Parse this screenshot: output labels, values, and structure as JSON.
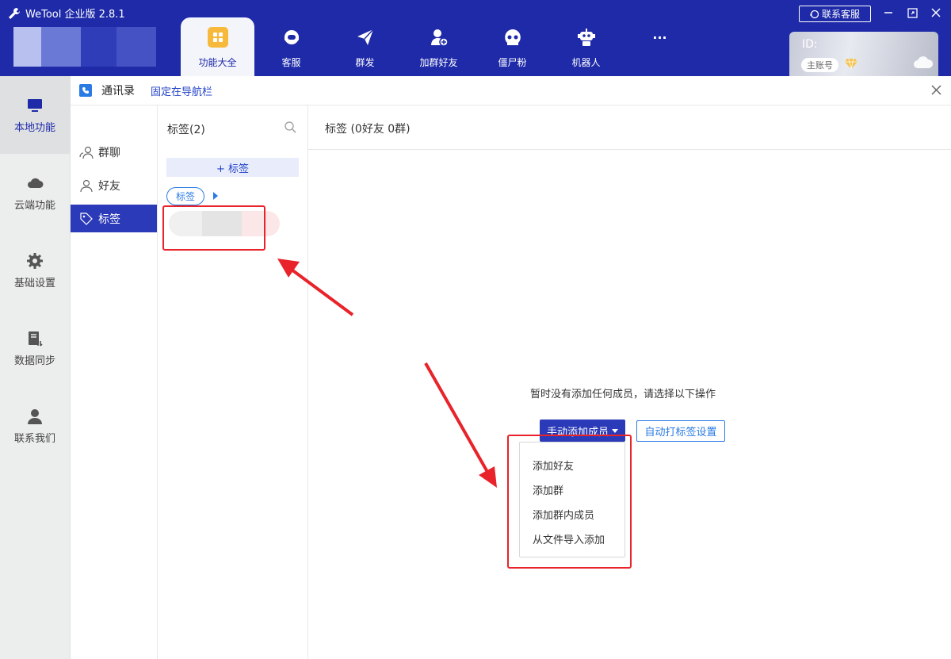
{
  "app": {
    "title": "WeTool 企业版 2.8.1"
  },
  "nav": [
    {
      "label": "功能大全",
      "icon": "grid-icon",
      "active": true
    },
    {
      "label": "客服",
      "icon": "headset-icon"
    },
    {
      "label": "群发",
      "icon": "paper-plane-icon"
    },
    {
      "label": "加群好友",
      "icon": "add-user-icon"
    },
    {
      "label": "僵尸粉",
      "icon": "skull-icon"
    },
    {
      "label": "机器人",
      "icon": "robot-icon"
    },
    {
      "label": "···",
      "icon": "more-icon"
    }
  ],
  "header_right": {
    "contact_label": "联系客服"
  },
  "account": {
    "id_label": "ID:",
    "badge": "主账号"
  },
  "sidebar": [
    {
      "label": "本地功能",
      "icon": "monitor-icon",
      "active": true
    },
    {
      "label": "云端功能",
      "icon": "cloud-icon"
    },
    {
      "label": "基础设置",
      "icon": "gear-icon"
    },
    {
      "label": "数据同步",
      "icon": "sync-icon"
    },
    {
      "label": "联系我们",
      "icon": "person-icon"
    }
  ],
  "breadcrumb": {
    "title": "通讯录",
    "pin_label": "固定在导航栏"
  },
  "submenu": [
    {
      "label": "群聊",
      "icon": "group-icon"
    },
    {
      "label": "好友",
      "icon": "user-icon"
    },
    {
      "label": "标签",
      "icon": "tag-icon",
      "active": true
    }
  ],
  "taglist": {
    "header": "标签(2)",
    "add_label": "+ 标签",
    "tags": [
      "标签"
    ]
  },
  "main": {
    "header": "标签 (0好友 0群)",
    "empty_text": "暂时没有添加任何成员，请选择以下操作",
    "manual_add_label": "手动添加成员",
    "auto_tag_label": "自动打标签设置",
    "dropdown": [
      "添加好友",
      "添加群",
      "添加群内成员",
      "从文件导入添加"
    ]
  },
  "colors": {
    "brand": "#1e2aa8",
    "accent": "#2b3ab8",
    "link": "#2a7be4",
    "annotation": "#e8232a"
  }
}
